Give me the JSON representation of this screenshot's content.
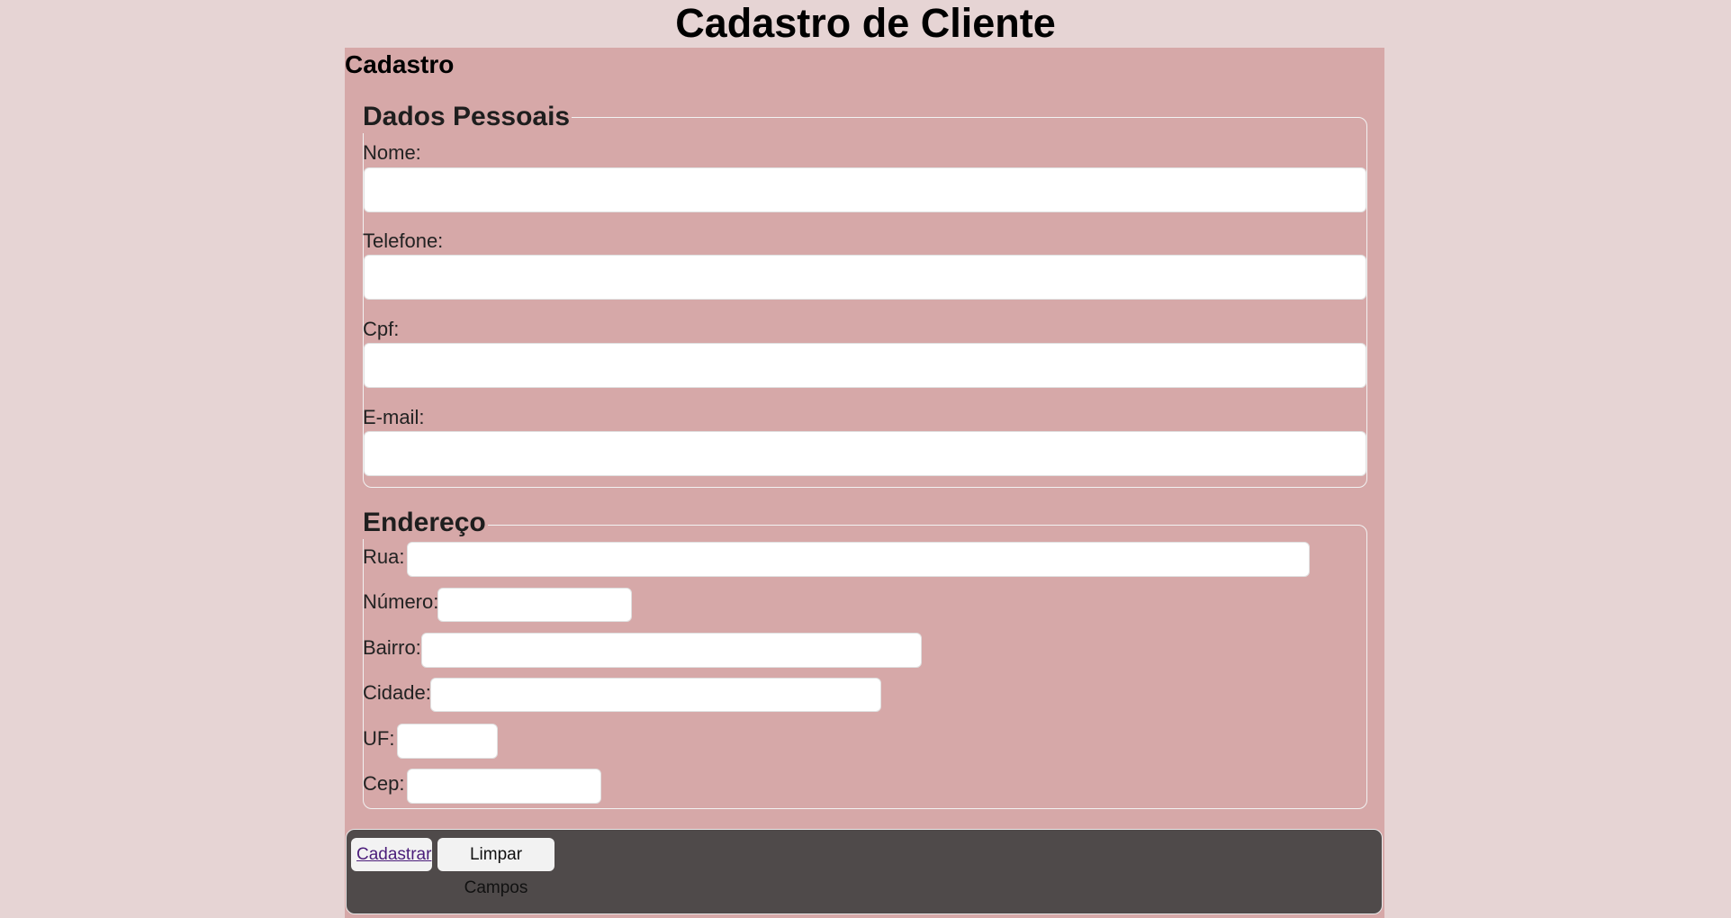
{
  "page": {
    "title": "Cadastro de Cliente"
  },
  "form": {
    "heading": "Cadastro",
    "personal": {
      "legend": "Dados Pessoais",
      "fields": {
        "nome": {
          "label": "Nome:",
          "value": ""
        },
        "telefone": {
          "label": "Telefone:",
          "value": ""
        },
        "cpf": {
          "label": "Cpf:",
          "value": ""
        },
        "email": {
          "label": "E-mail:",
          "value": ""
        }
      }
    },
    "address": {
      "legend": "Endereço",
      "fields": {
        "rua": {
          "label": "Rua:",
          "value": ""
        },
        "numero": {
          "label": "Número:",
          "value": ""
        },
        "bairro": {
          "label": "Bairro:",
          "value": ""
        },
        "cidade": {
          "label": "Cidade:",
          "value": ""
        },
        "uf": {
          "label": "UF:",
          "value": ""
        },
        "cep": {
          "label": "Cep:",
          "value": ""
        }
      }
    },
    "actions": {
      "submit_label": "Cadastrar",
      "clear_label": "Limpar Campos"
    }
  },
  "colors": {
    "page_background": "#e6d4d4",
    "panel_background": "#d6a8a8",
    "footer_background": "#4f4a4a",
    "link_color": "#4b1d7a"
  }
}
